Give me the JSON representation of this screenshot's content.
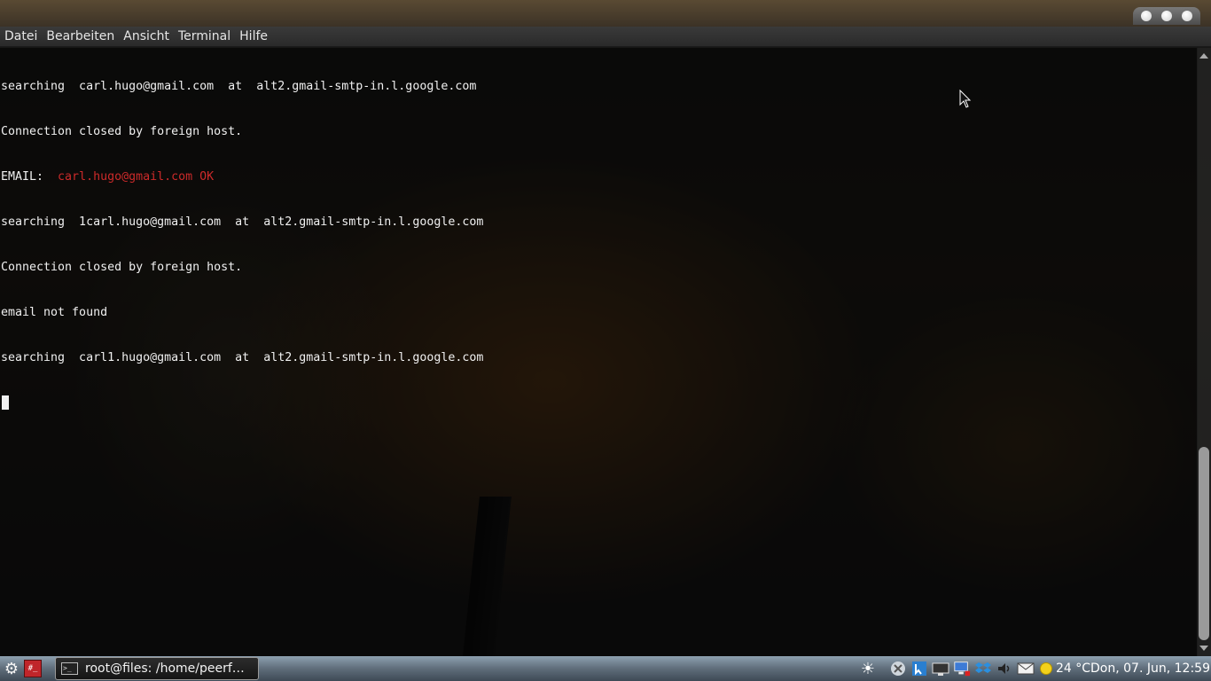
{
  "window": {
    "controls": [
      "minimize",
      "maximize",
      "close"
    ]
  },
  "menu": {
    "items": [
      "Datei",
      "Bearbeiten",
      "Ansicht",
      "Terminal",
      "Hilfe"
    ]
  },
  "terminal": {
    "lines": [
      {
        "text": "searching  carl.hugo@gmail.com  at  alt2.gmail-smtp-in.l.google.com"
      },
      {
        "text": "Connection closed by foreign host."
      },
      {
        "prefix": "EMAIL:  ",
        "highlight": "carl.hugo@gmail.com OK",
        "highlight_color": "#cc2a2a"
      },
      {
        "text": "searching  1carl.hugo@gmail.com  at  alt2.gmail-smtp-in.l.google.com"
      },
      {
        "text": "Connection closed by foreign host."
      },
      {
        "text": "email not found"
      },
      {
        "text": "searching  carl1.hugo@gmail.com  at  alt2.gmail-smtp-in.l.google.com"
      }
    ]
  },
  "taskbar": {
    "app_menu_icon": "gear-icon",
    "launcher_icon": "terminal-icon",
    "task_label": "root@files: /home/peerf…",
    "tray_icons": [
      "brightness-icon",
      "network-x-icon",
      "update-icon",
      "display-icon",
      "network-icon",
      "dropbox-icon",
      "volume-icon",
      "mail-icon"
    ],
    "weather": "24 °C",
    "clock": "Don, 07. Jun, 12:59"
  },
  "colors": {
    "error_red": "#cc2a2a",
    "terminal_text": "#f0f0f0"
  }
}
